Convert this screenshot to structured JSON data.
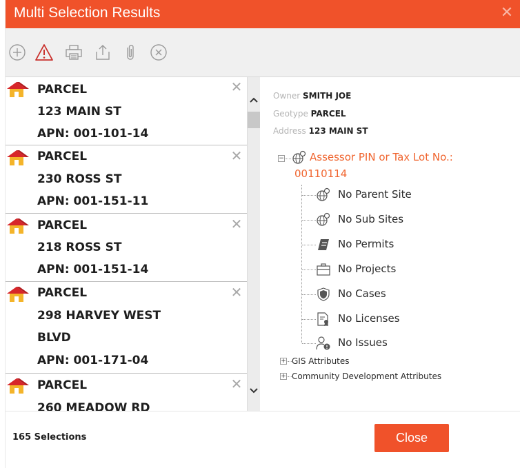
{
  "dialog": {
    "title": "Multi Selection Results",
    "accent_color": "#f0522a",
    "close_icon": "close-icon"
  },
  "toolbar": {
    "buttons": [
      {
        "icon": "add-icon"
      },
      {
        "icon": "warning-icon"
      },
      {
        "icon": "print-icon"
      },
      {
        "icon": "export-icon"
      },
      {
        "icon": "attach-icon"
      },
      {
        "icon": "remove-circle-icon"
      }
    ]
  },
  "selections": [
    {
      "type": "PARCEL",
      "address": "123 MAIN ST",
      "apn": "APN: 001-101-14"
    },
    {
      "type": "PARCEL",
      "address": "230 ROSS ST",
      "apn": "APN: 001-151-11"
    },
    {
      "type": "PARCEL",
      "address": "218 ROSS ST",
      "apn": "APN: 001-151-14"
    },
    {
      "type": "PARCEL",
      "address_line1": "298 HARVEY WEST",
      "address_line2": "BLVD",
      "apn": "APN: 001-171-04"
    },
    {
      "type": "PARCEL",
      "address": "260 MEADOW RD"
    }
  ],
  "details": {
    "owner_label": "Owner",
    "owner_value": "SMITH JOE",
    "geotype_label": "Geotype",
    "geotype_value": "PARCEL",
    "address_label": "Address",
    "address_value": "123 MAIN ST",
    "tree": {
      "root_label_line1": "Assessor PIN or Tax Lot No.:",
      "root_label_line2": "00110114",
      "children": [
        {
          "label": "No Parent Site",
          "icon": "globe-pin-icon"
        },
        {
          "label": "No Sub Sites",
          "icon": "globe-pin-icon"
        },
        {
          "label": "No Permits",
          "icon": "permit-icon"
        },
        {
          "label": "No Projects",
          "icon": "briefcase-icon"
        },
        {
          "label": "No Cases",
          "icon": "shield-icon"
        },
        {
          "label": "No Licenses",
          "icon": "license-icon"
        },
        {
          "label": "No Issues",
          "icon": "issue-icon"
        }
      ],
      "collapsed": [
        {
          "label": "GIS Attributes"
        },
        {
          "label": "Community Development Attributes"
        }
      ]
    }
  },
  "footer": {
    "selection_count": "165 Selections",
    "close_label": "Close"
  }
}
